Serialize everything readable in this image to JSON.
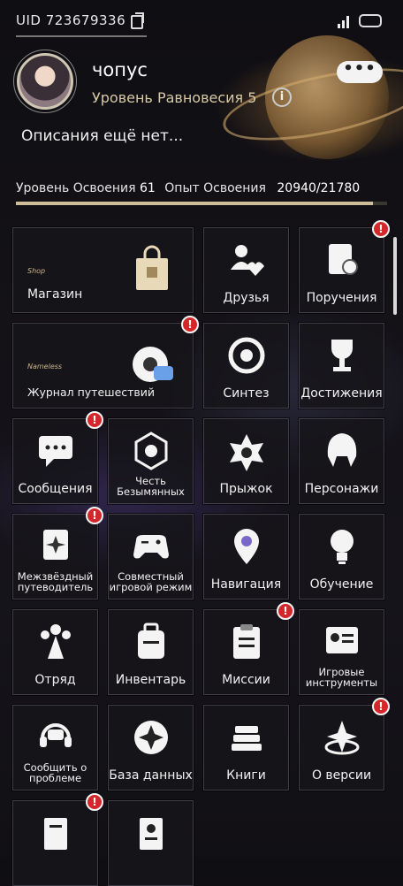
{
  "header": {
    "uid": "UID 723679336",
    "nickname": "чопус",
    "level_label": "Уровень Равновесия 5",
    "description": "Описания ещё нет...",
    "more_label": "•••"
  },
  "experience": {
    "level_label": "Уровень Освоения",
    "level_value": "61",
    "exp_label": "Опыт Освоения",
    "exp_value": "20940/21780",
    "progress_fraction": 0.961
  },
  "tiles": [
    {
      "id": "shop",
      "label": "Магазин",
      "tag": "Shop",
      "wide": true,
      "badge": false,
      "icon": "shopping-bag-icon"
    },
    {
      "id": "friends",
      "label": "Друзья",
      "badge": false,
      "icon": "friends-icon"
    },
    {
      "id": "assignments",
      "label": "Поручения",
      "badge": true,
      "icon": "assignments-icon"
    },
    {
      "id": "journal",
      "label": "Журнал путешествий",
      "tag": "Nameless",
      "wide": true,
      "badge": true,
      "small": true,
      "icon": "travel-journal-icon"
    },
    {
      "id": "synthesis",
      "label": "Синтез",
      "badge": false,
      "icon": "synthesis-icon"
    },
    {
      "id": "achievements",
      "label": "Достижения",
      "badge": false,
      "icon": "trophy-icon"
    },
    {
      "id": "messages",
      "label": "Сообщения",
      "badge": true,
      "icon": "chat-icon"
    },
    {
      "id": "nameless-honor",
      "label": "Честь Безымянных",
      "badge": false,
      "small": true,
      "icon": "nameless-honor-icon"
    },
    {
      "id": "warp",
      "label": "Прыжок",
      "badge": false,
      "icon": "warp-icon"
    },
    {
      "id": "characters",
      "label": "Персонажи",
      "badge": false,
      "icon": "character-icon"
    },
    {
      "id": "guide",
      "label": "Межзвёздный путеводитель",
      "badge": true,
      "small": true,
      "icon": "interastral-guide-icon"
    },
    {
      "id": "coop",
      "label": "Совместный игровой режим",
      "badge": false,
      "small": true,
      "icon": "gamepad-icon"
    },
    {
      "id": "navigation",
      "label": "Навигация",
      "badge": false,
      "icon": "map-pin-icon"
    },
    {
      "id": "tutorial",
      "label": "Обучение",
      "badge": false,
      "icon": "lightbulb-icon"
    },
    {
      "id": "team",
      "label": "Отряд",
      "badge": false,
      "icon": "team-icon"
    },
    {
      "id": "inventory",
      "label": "Инвентарь",
      "badge": false,
      "icon": "backpack-icon"
    },
    {
      "id": "missions",
      "label": "Миссии",
      "badge": true,
      "icon": "clipboard-icon"
    },
    {
      "id": "tools",
      "label": "Игровые инструменты",
      "badge": false,
      "small": true,
      "icon": "game-tools-icon"
    },
    {
      "id": "report",
      "label": "Сообщить о проблеме",
      "badge": false,
      "small": true,
      "icon": "support-headset-icon"
    },
    {
      "id": "database",
      "label": "База данных",
      "badge": false,
      "icon": "database-icon"
    },
    {
      "id": "books",
      "label": "Книги",
      "badge": false,
      "icon": "books-icon"
    },
    {
      "id": "version",
      "label": "О версии",
      "badge": true,
      "icon": "version-icon"
    },
    {
      "id": "extra1",
      "label": "",
      "badge": true,
      "icon": "document-icon"
    },
    {
      "id": "extra2",
      "label": "",
      "badge": false,
      "icon": "contact-card-icon"
    }
  ],
  "badge_glyph": "!",
  "colors": {
    "badge": "#d4272b",
    "accent": "#cdbd98",
    "tile_border": "#3f3d45"
  }
}
